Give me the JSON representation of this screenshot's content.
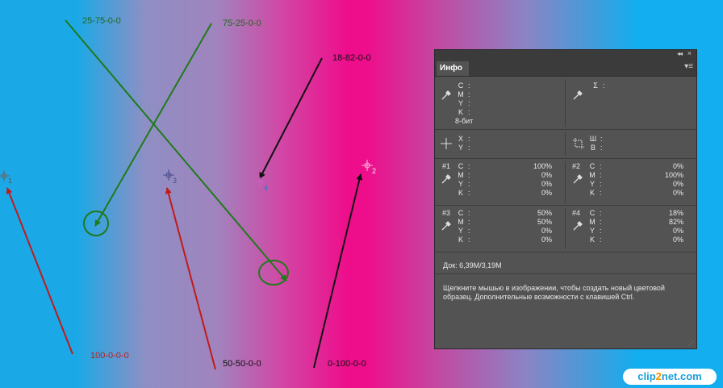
{
  "canvas": {
    "annotations": {
      "a1": "25-75-0-0",
      "a2": "75-25-0-0",
      "a3": "18-82-0-0",
      "a4": "100-0-0-0",
      "a5": "50-50-0-0",
      "a6": "0-100-0-0"
    },
    "samplers": [
      "1",
      "2",
      "3",
      "4"
    ],
    "colors": {
      "green": "#1f7a1a",
      "red": "#c11a1a",
      "black": "#111111"
    }
  },
  "panel": {
    "tab_label": "Инфо",
    "top": {
      "left_labels": [
        "C",
        "M",
        "Y",
        "K"
      ],
      "bit_depth": "8-бит",
      "sigma": "Σ"
    },
    "coords": {
      "xy_labels": [
        "X",
        "Y"
      ],
      "wh_labels": [
        "Ш",
        "В"
      ]
    },
    "samples": [
      {
        "id": "#1",
        "values": [
          "100%",
          "0%",
          "0%",
          "0%"
        ]
      },
      {
        "id": "#2",
        "values": [
          "0%",
          "100%",
          "0%",
          "0%"
        ]
      },
      {
        "id": "#3",
        "values": [
          "50%",
          "50%",
          "0%",
          "0%"
        ]
      },
      {
        "id": "#4",
        "values": [
          "18%",
          "82%",
          "0%",
          "0%"
        ]
      }
    ],
    "doc": "Док: 6,39M/3,19M",
    "hint": "Щелкните мышью в изображении, чтобы создать новый цветовой образец. Дополнительные возможности с клавишей Ctrl."
  },
  "watermark": {
    "part1": "clip",
    "part2": "2",
    "part3": "net.com"
  }
}
